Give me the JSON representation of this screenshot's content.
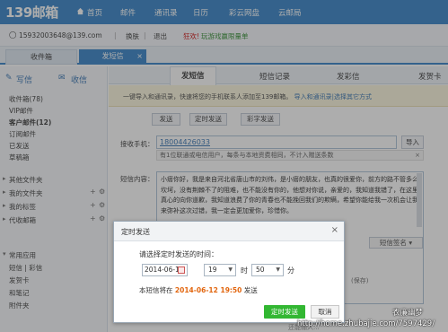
{
  "header": {
    "logo": "139邮箱",
    "nav": [
      "首页",
      "邮件",
      "通讯录",
      "日历",
      "彩云网盘",
      "云邮局"
    ]
  },
  "userbar": {
    "account": "15932003648@139.com",
    "switch": "换肤",
    "logout": "退出",
    "promo_a": "狂欢!",
    "promo_b": "玩游戏赢限量单"
  },
  "tabs": {
    "inbox": "收件箱",
    "sms": "发短信",
    "sms_close": "×"
  },
  "sidebar": {
    "compose": "写信",
    "receive": "收信",
    "items": [
      {
        "label": "收件箱(78)"
      },
      {
        "label": "VIP邮件"
      },
      {
        "label": "客户邮件(12)"
      },
      {
        "label": "订阅邮件"
      },
      {
        "label": "已发送"
      },
      {
        "label": "草稿箱"
      }
    ],
    "sections": [
      {
        "label": "其他文件夹"
      },
      {
        "label": "我的文件夹"
      },
      {
        "label": "我的标签"
      },
      {
        "label": "代收邮箱"
      }
    ],
    "apps_title": "常用应用",
    "apps_row1": "短信  |  彩信",
    "apps": [
      "发贺卡",
      "和笔记",
      "附件夹"
    ]
  },
  "content": {
    "subtabs": [
      "发短信",
      "短信记录",
      "发彩信",
      "发贺卡"
    ],
    "tip": "一键导入和通讯录，快速将您的手机联系人添加至139邮箱。",
    "tip_link": "导入和通讯录|选择其它方式",
    "modes": [
      "发送",
      "定时发送",
      "彩字发送"
    ],
    "recv_label": "接收手机：",
    "recv_number": "18004426033",
    "import_btn": "导入",
    "recv_note": "有1位联通或电信用户，每条与本地资费相同，不计入赠送条数",
    "recv_note_close": "×",
    "msg_label": "短信内容：",
    "msg_body": "小瘩你好，我是来自河北省唐山市的刘伟，是小瘩的朋友，也真的很爱你，前方的路不管多么坎坷，没有荆棘不了的阻难，也不能没有你的，他想对你说，亲爱的，我知道我错了，在这里真心的向你道歉，我知道浪费了你的青春也不能挽回我们的欺瞒，希望你能给我一次机会让我来弥补这次过错，我一定会更加爱你，珍惜你。",
    "sig_select": "短信签名",
    "save_note": "(保存)",
    "bottom_note": "还能输入..."
  },
  "dialog": {
    "title": "定时发送",
    "close": "×",
    "prompt": "请选择定时发送的时间：",
    "date": "2014-06-12",
    "hour": "19",
    "hour_unit": "时",
    "minute": "50",
    "minute_unit": "分",
    "summary_pre": "本短信将在",
    "summary_time": "2014-06-12 19:50",
    "summary_post": "发送",
    "ok": "定时发送",
    "cancel": "取消"
  },
  "watermark": {
    "line1": "衣廉幽梦",
    "line2": "http://home.zhubajie.com/7597429/"
  },
  "colors": {
    "brand": "#2f7fc6",
    "ok_button": "#32b732",
    "highlight": "#e2660f"
  }
}
